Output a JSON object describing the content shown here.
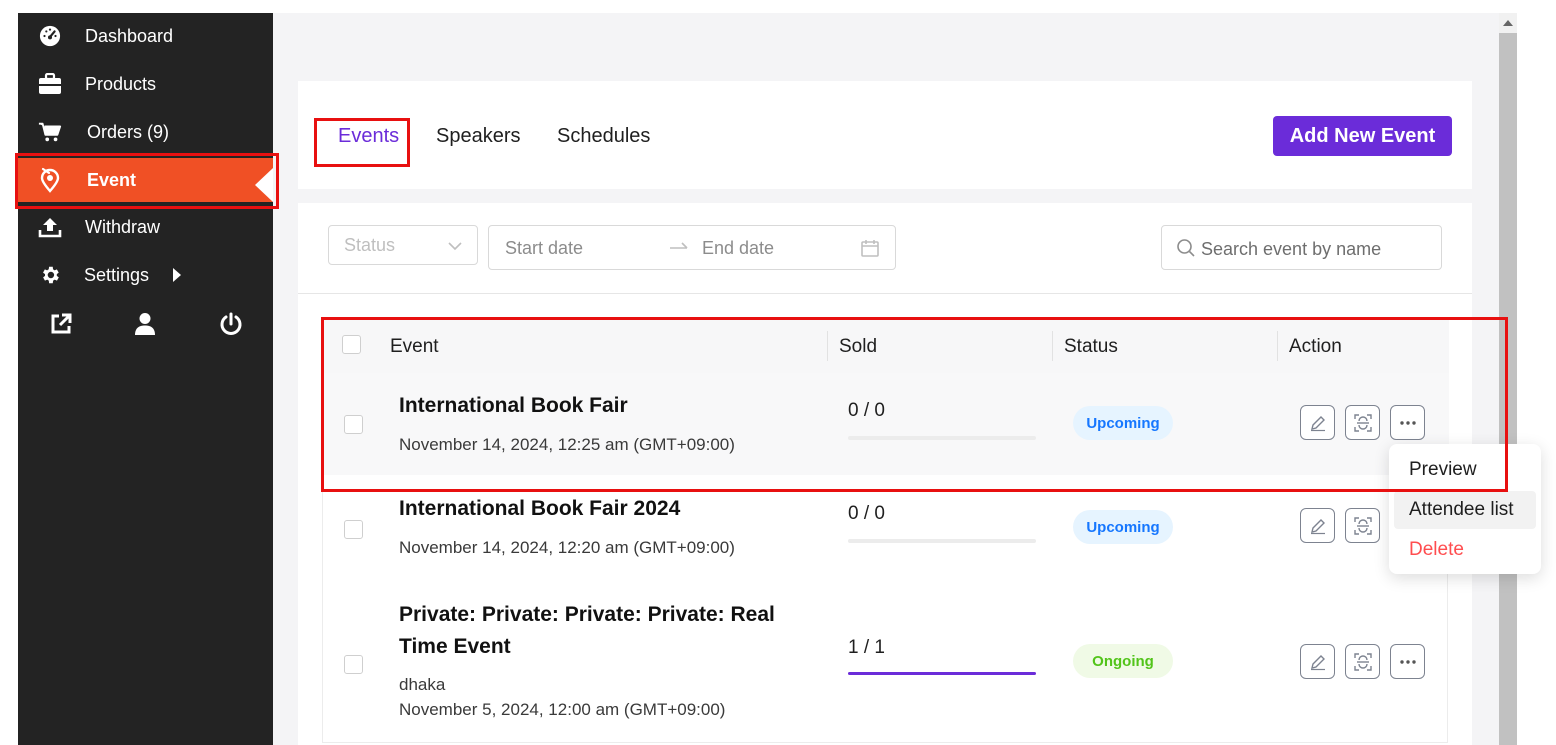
{
  "sidebar": {
    "items": [
      {
        "label": "Dashboard",
        "icon": "dashboard-gauge-icon"
      },
      {
        "label": "Products",
        "icon": "briefcase-icon"
      },
      {
        "label": "Orders (9)",
        "icon": "cart-icon"
      },
      {
        "label": "Event",
        "icon": "event-pin-icon",
        "active": true
      },
      {
        "label": "Withdraw",
        "icon": "upload-icon"
      },
      {
        "label": "Settings",
        "icon": "gear-icon"
      }
    ],
    "footer_icons": [
      "external-link-icon",
      "user-icon",
      "power-icon"
    ],
    "active_color": "#f05025",
    "background": "#232323"
  },
  "tabs": {
    "items": [
      "Events",
      "Speakers",
      "Schedules"
    ],
    "active": "Events",
    "add_button": "Add New Event"
  },
  "filters": {
    "status_placeholder": "Status",
    "start_date_placeholder": "Start date",
    "end_date_placeholder": "End date",
    "search_placeholder": "Search event by name"
  },
  "table": {
    "headers": {
      "event": "Event",
      "sold": "Sold",
      "status": "Status",
      "action": "Action"
    },
    "rows": [
      {
        "title": "International Book Fair",
        "location": "",
        "date": "November 14, 2024, 12:25 am (GMT+09:00)",
        "sold": "0 / 0",
        "sold_fraction": 0,
        "status": "Upcoming"
      },
      {
        "title": "International Book Fair 2024",
        "location": "",
        "date": "November 14, 2024, 12:20 am (GMT+09:00)",
        "sold": "0 / 0",
        "sold_fraction": 0,
        "status": "Upcoming"
      },
      {
        "title": "Private: Private: Private: Private: Real Time Event",
        "location": "dhaka",
        "date": "November 5, 2024, 12:00 am (GMT+09:00)",
        "sold": "1 / 1",
        "sold_fraction": 1,
        "status": "Ongoing"
      }
    ]
  },
  "dropdown": {
    "items": [
      "Preview",
      "Attendee list",
      "Delete"
    ]
  },
  "colors": {
    "accent": "#6b2cd9",
    "upcoming_text": "#1677ff",
    "ongoing_text": "#52c41a",
    "danger": "#ff4d4f",
    "highlight": "#e81010"
  }
}
